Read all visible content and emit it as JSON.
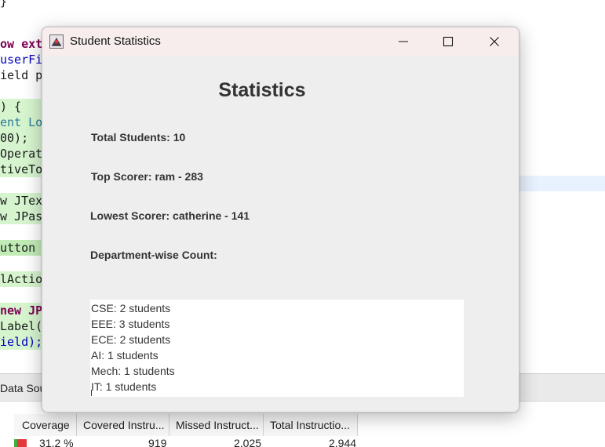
{
  "background_ide": {
    "code_fragments": [
      "}",
      "ow exte",
      "userFi",
      "ield pa",
      ") {",
      "ent Log",
      "00);",
      "Operat",
      "tiveTo",
      "w JText",
      "w JPass",
      "utton =",
      "lAction",
      "new JP",
      "Label(",
      "ield);"
    ],
    "bottom_tab": "Data Sou",
    "coverage_columns": [
      "Coverage",
      "Covered Instru...",
      "Missed Instruct...",
      "Total Instructio..."
    ],
    "coverage_row": {
      "coverage": "31.2 %",
      "covered": "919",
      "missed": "2,025",
      "total": "2,944"
    }
  },
  "dialog": {
    "title": "Student Statistics",
    "heading": "Statistics",
    "total_students": "Total Students: 10",
    "top_scorer": "Top Scorer: ram - 283",
    "lowest_scorer": "Lowest Scorer: catherine - 141",
    "department_label": "Department-wise Count:",
    "department_counts": [
      "CSE: 2 students",
      "EEE: 3 students",
      "ECE: 2 students",
      "AI: 1 students",
      "Mech: 1 students",
      "IT: 1 students"
    ]
  },
  "colors": {
    "titlebar": "#f7eded",
    "dialog_bg": "#eeeeee",
    "code_highlight": "#d6f5cf",
    "coverage_red": "#e23a3a"
  }
}
